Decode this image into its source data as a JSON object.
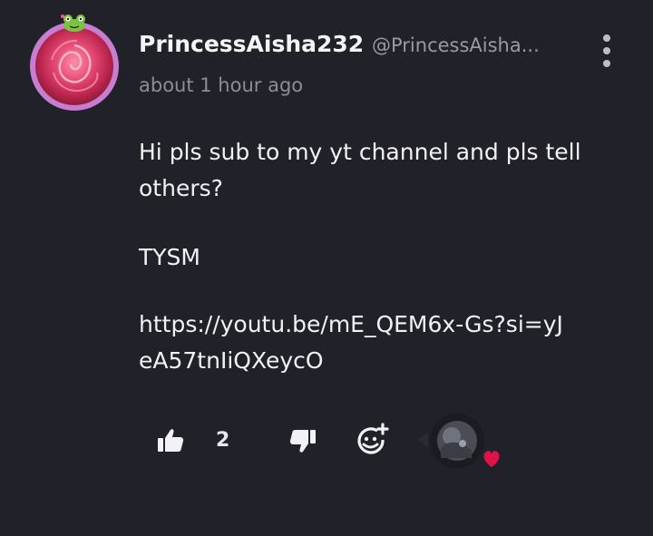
{
  "comment": {
    "username": "PrincessAisha232",
    "handle": "@PrincessAisha...",
    "timestamp": "about 1 hour ago",
    "body_line1": "Hi pls sub to my yt channel and pls tell others?",
    "body_line2": "TYSM",
    "link": "https://youtu.be/mE_QEM6x-Gs?si=yJeA57tnIiQXeycO",
    "like_count": "2"
  },
  "icons": {
    "like": "thumbs-up-icon",
    "dislike": "thumbs-down-icon",
    "reaction": "add-reaction-icon",
    "more": "more-vertical-icon",
    "heart": "heart-icon"
  },
  "colors": {
    "background": "#212129",
    "text": "#f2f2f4",
    "muted": "#8d8d96",
    "avatar_ring": "#c77dd0",
    "heart": "#e0124a"
  }
}
